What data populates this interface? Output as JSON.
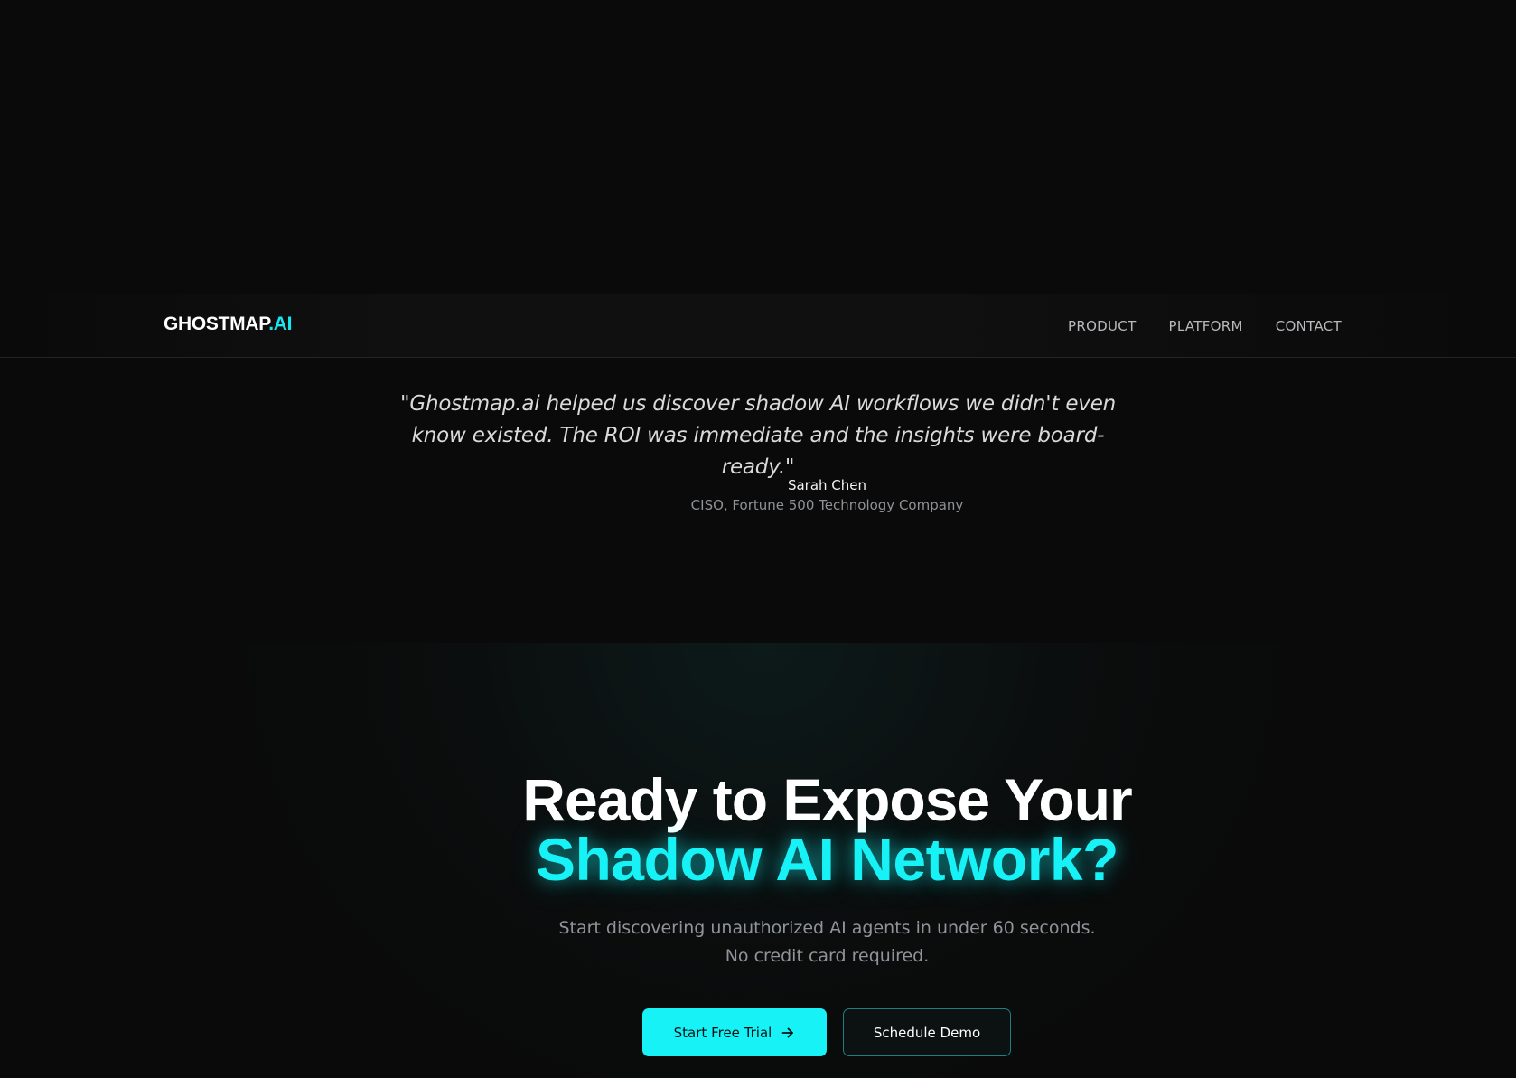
{
  "nav": {
    "logo_main": "GHOSTMAP",
    "logo_accent": ".AI",
    "links": [
      "PRODUCT",
      "PLATFORM",
      "CONTACT"
    ]
  },
  "testimonial": {
    "quote": "\"Ghostmap.ai helped us discover shadow AI workflows we didn't even know existed. The ROI was immediate and the insights were board-ready.\"",
    "author": "Sarah Chen",
    "role": "CISO, Fortune 500 Technology Company"
  },
  "cta": {
    "title_line1": "Ready to Expose Your",
    "title_line2": "Shadow AI Network?",
    "subtitle_line1": "Start discovering unauthorized AI agents in under 60 seconds.",
    "subtitle_line2": "No credit card required.",
    "primary_button": "Start Free Trial",
    "primary_icon": "arrow-right-icon",
    "secondary_button": "Schedule Demo"
  },
  "colors": {
    "background": "#0a0a0a",
    "accent": "#16f2f6",
    "logo_accent": "#18e6f0",
    "secondary_border": "#1d7f82"
  }
}
